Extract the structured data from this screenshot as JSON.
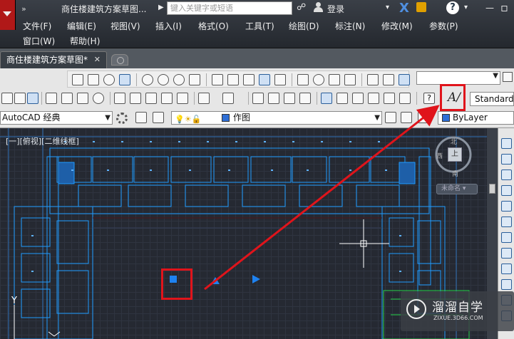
{
  "titlebar": {
    "doc_title": "商住楼建筑方案草图...",
    "search_placeholder": "键入关键字或短语",
    "login_label": "登录"
  },
  "menu": {
    "row1": [
      "文件(F)",
      "编辑(E)",
      "视图(V)",
      "插入(I)",
      "格式(O)",
      "工具(T)",
      "绘图(D)",
      "标注(N)",
      "修改(M)",
      "参数(P)"
    ],
    "row2": [
      "窗口(W)",
      "帮助(H)"
    ]
  },
  "tabs": {
    "active_label": "商住楼建筑方案草图*",
    "close_glyph": "✕"
  },
  "toolbar": {
    "text_style_value": "Standard",
    "workspace_value": "AutoCAD 经典",
    "layer_value": "作图",
    "color_value": "ByLayer",
    "help_glyph": "?"
  },
  "canvas": {
    "viewport_label": "[一][俯视][二维线框]",
    "viewcube_north": "北",
    "viewcube_south": "南",
    "viewcube_west": "西",
    "viewcube_top": "上",
    "wcs_label": "未命名 ▾",
    "ucs_y": "Y"
  },
  "watermark": {
    "title": "溜溜自学",
    "url": "ZIXUE.3D66.COM"
  },
  "colors": {
    "annotation_red": "#e0141b",
    "drawing_cyan": "#1ea0ff",
    "canvas_bg": "#252932"
  },
  "icons": [
    "app-logo-icon",
    "search-icon",
    "user-icon",
    "autodesk-x-icon",
    "exchange-icon",
    "help-icon",
    "gear-icon",
    "text-style-icon",
    "close-icon"
  ]
}
